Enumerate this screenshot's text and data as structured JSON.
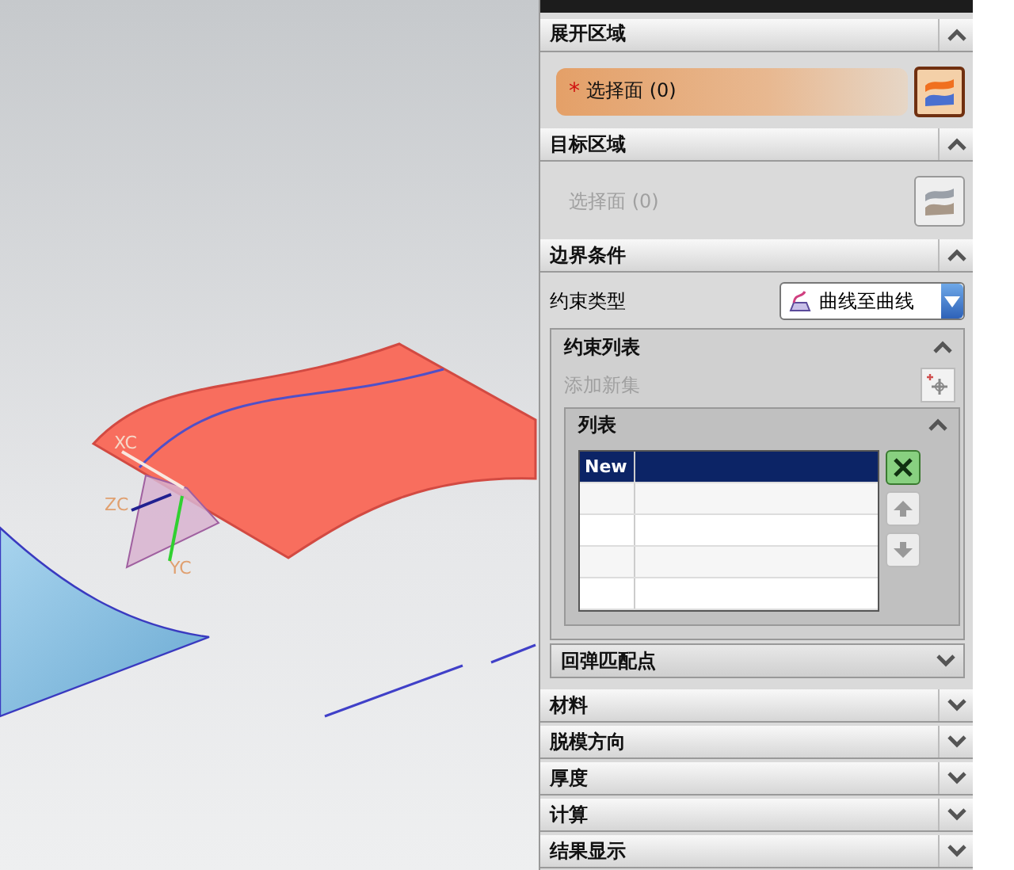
{
  "viewport": {
    "axis_labels": [
      "XC",
      "ZC",
      "YC"
    ]
  },
  "panel": {
    "expand_region": {
      "title": "展开区域",
      "expanded": true,
      "select": {
        "label": "选择面 (0)",
        "required_mark": "*",
        "active": true
      }
    },
    "target_region": {
      "title": "目标区域",
      "expanded": true,
      "select": {
        "label": "选择面 (0)",
        "active": false
      }
    },
    "boundary": {
      "title": "边界条件",
      "expanded": true,
      "constraint_type": {
        "label": "约束类型",
        "value": "曲线至曲线"
      },
      "constraint_list": {
        "title": "约束列表",
        "expanded": true,
        "add_new_set": {
          "label": "添加新集",
          "disabled": true
        },
        "list": {
          "title": "列表",
          "expanded": true,
          "rows": [
            {
              "name": "New",
              "selected": true
            },
            {
              "selected": false
            },
            {
              "selected": false
            },
            {
              "selected": false
            },
            {
              "selected": false
            }
          ],
          "actions": [
            {
              "kind": "delete",
              "disabled": false
            },
            {
              "kind": "up",
              "disabled": true
            },
            {
              "kind": "down",
              "disabled": true
            }
          ]
        }
      },
      "springback": {
        "title": "回弹匹配点",
        "expanded": false
      }
    },
    "collapsed": [
      {
        "title": "材料",
        "expanded": false
      },
      {
        "title": "脱模方向",
        "expanded": false
      },
      {
        "title": "厚度",
        "expanded": false
      },
      {
        "title": "计算",
        "expanded": false
      },
      {
        "title": "结果显示",
        "expanded": false
      }
    ]
  }
}
